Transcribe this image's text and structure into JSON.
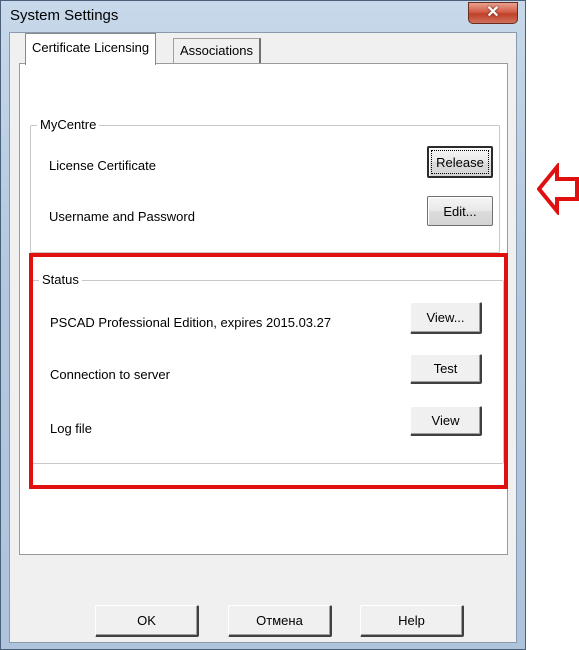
{
  "window": {
    "title": "System Settings"
  },
  "tabs": [
    {
      "label": "Certificate Licensing",
      "active": true
    },
    {
      "label": "Associations",
      "active": false
    }
  ],
  "mycentre": {
    "title": "MyCentre",
    "rows": [
      {
        "label": "License Certificate",
        "button": "Release"
      },
      {
        "label": "Username and Password",
        "button": "Edit..."
      }
    ]
  },
  "status": {
    "title": "Status",
    "rows": [
      {
        "label": "PSCAD Professional Edition, expires 2015.03.27",
        "button": "View..."
      },
      {
        "label": "Connection to server",
        "button": "Test"
      },
      {
        "label": "Log file",
        "button": "View"
      }
    ]
  },
  "footer": {
    "ok": "OK",
    "cancel": "Отмена",
    "help": "Help"
  },
  "colors": {
    "highlight": "#e01010"
  }
}
